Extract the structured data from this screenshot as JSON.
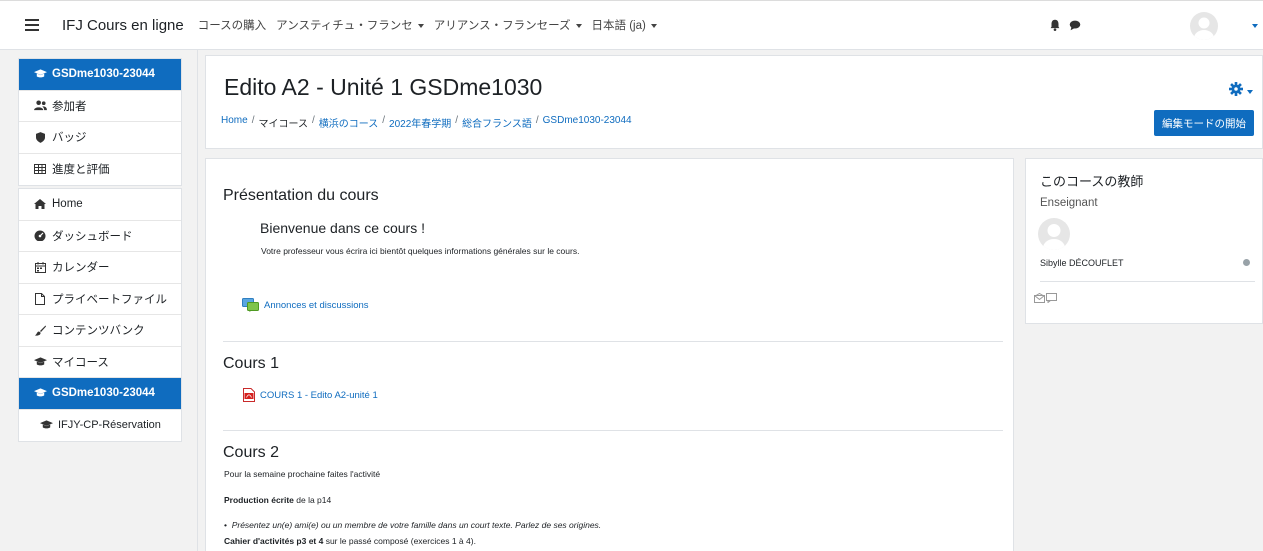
{
  "navbar": {
    "brand": "IFJ Cours en ligne",
    "menu": [
      "コースの購入",
      "アンスティチュ・フランセ",
      "アリアンス・フランセーズ",
      "日本語 (ja)"
    ]
  },
  "drawer": {
    "group1": [
      {
        "label": "GSDme1030-23044",
        "icon": "graduation-cap-icon",
        "active": true
      },
      {
        "label": "参加者",
        "icon": "users-icon",
        "active": false
      },
      {
        "label": "バッジ",
        "icon": "shield-icon",
        "active": false
      },
      {
        "label": "進度と評価",
        "icon": "table-icon",
        "active": false
      }
    ],
    "group2": [
      {
        "label": "Home",
        "icon": "home-icon",
        "active": false
      },
      {
        "label": "ダッシュボード",
        "icon": "dashboard-icon",
        "active": false
      },
      {
        "label": "カレンダー",
        "icon": "calendar-icon",
        "active": false
      },
      {
        "label": "プライベートファイル",
        "icon": "file-icon",
        "active": false
      },
      {
        "label": "コンテンツバンク",
        "icon": "brush-icon",
        "active": false
      },
      {
        "label": "マイコース",
        "icon": "graduation-cap-icon",
        "active": false
      },
      {
        "label": "GSDme1030-23044",
        "icon": "graduation-cap-icon",
        "active": true
      },
      {
        "label": "IFJY-CP-Réservation",
        "icon": "graduation-cap-icon",
        "active": false
      }
    ]
  },
  "header": {
    "title": "Edito A2 - Unité 1 GSDme1030",
    "breadcrumb": [
      "Home",
      "マイコース",
      "横浜のコース",
      "2022年春学期",
      "総合フランス語",
      "GSDme1030-23044"
    ],
    "edit_button": "編集モードの開始"
  },
  "main": {
    "section0": {
      "title": "Présentation du cours",
      "welcome_title": "Bienvenue dans ce cours !",
      "welcome_text": "Votre professeur vous écrira ici bientôt quelques informations générales sur le cours.",
      "forum_link": "Annonces et discussions"
    },
    "section1": {
      "title": "Cours 1",
      "resource_link": "COURS 1 - Edito A2-unité 1"
    },
    "section2": {
      "title": "Cours 2",
      "line1": "Pour la semaine prochaine faites l'activité",
      "line2_bold": "Production écrite",
      "line2_rest": " de la p14",
      "bullet": "Présentez un(e) ami(e) ou un membre de votre famille dans un court texte. Parlez de ses origines.",
      "line4_bold": "Cahier d'activités p3 et 4",
      "line4_rest": " sur le passé composé (exercices 1 à 4)."
    }
  },
  "block": {
    "title": "このコースの教師",
    "role": "Enseignant",
    "teacher_name": "Sibylle DÉCOUFLET"
  },
  "colors": {
    "primary": "#0f6cbf",
    "background": "#f2f2f2"
  }
}
